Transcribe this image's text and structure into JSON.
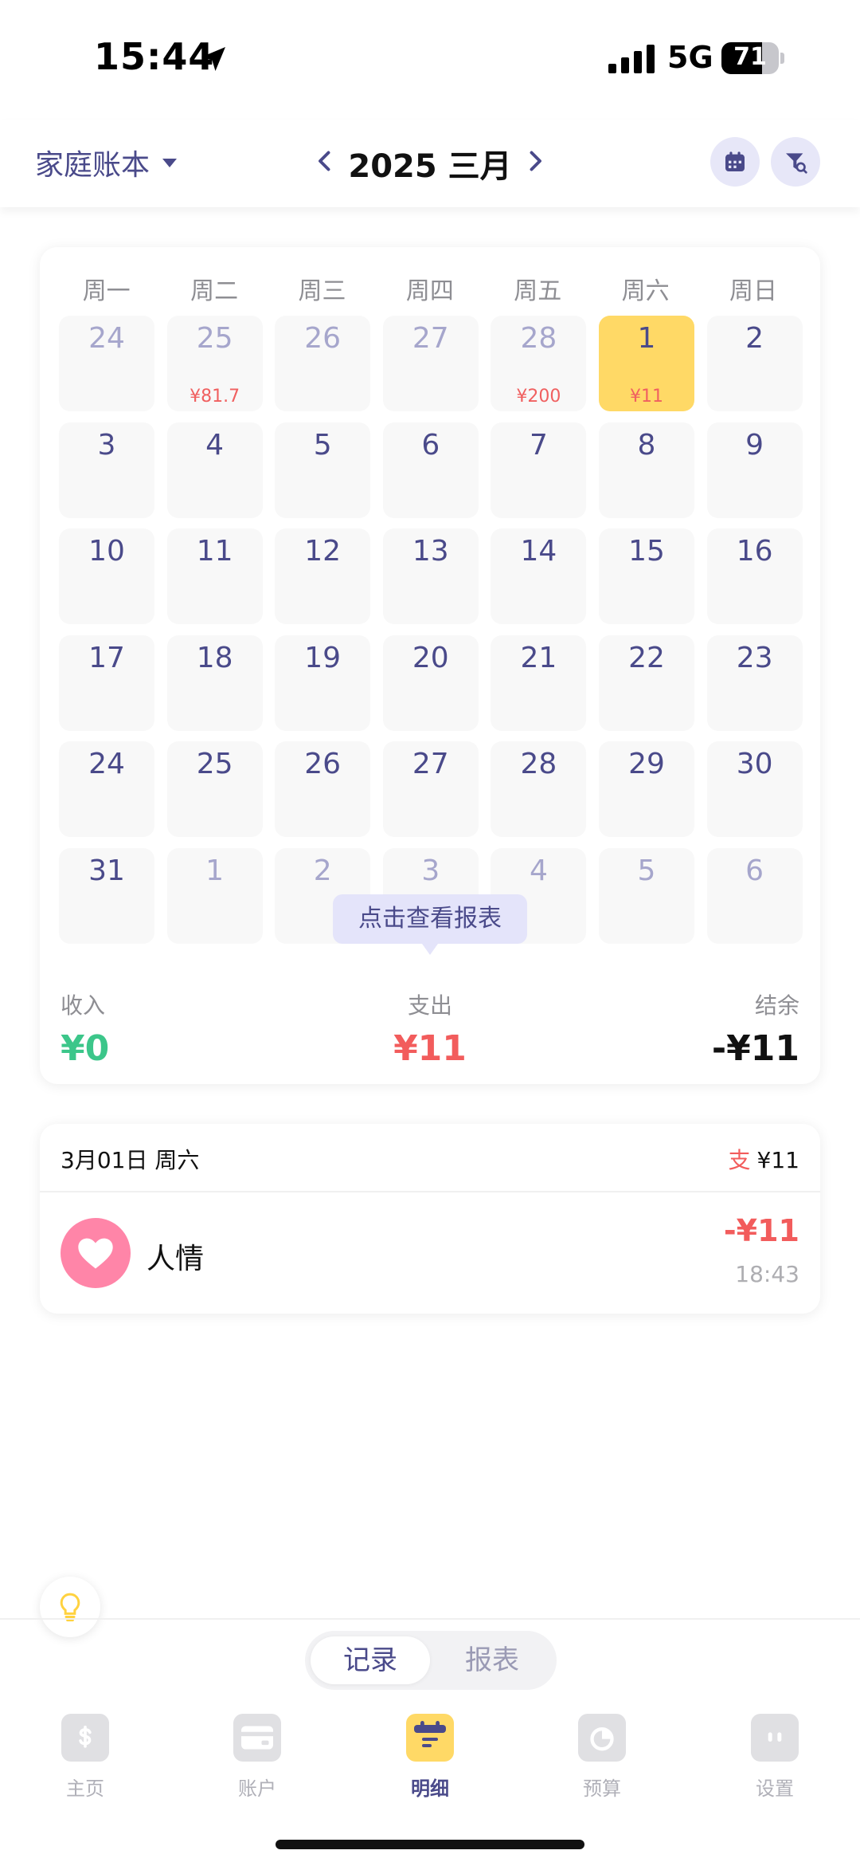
{
  "status_bar": {
    "time": "15:44",
    "network": "5G",
    "battery_level": "71",
    "battery_fraction": 0.71
  },
  "header": {
    "ledger_name": "家庭账本",
    "month_title": "2025 三月",
    "icons": {
      "calendar": "calendar-icon",
      "filter": "filter-search-icon",
      "prev": "chevron-left-icon",
      "next": "chevron-right-icon"
    }
  },
  "calendar": {
    "weekdays": [
      "周一",
      "周二",
      "周三",
      "周四",
      "周五",
      "周六",
      "周日"
    ],
    "weeks": [
      [
        {
          "day": "24",
          "muted": true,
          "amount": ""
        },
        {
          "day": "25",
          "muted": true,
          "amount": "¥81.7"
        },
        {
          "day": "26",
          "muted": true,
          "amount": ""
        },
        {
          "day": "27",
          "muted": true,
          "amount": ""
        },
        {
          "day": "28",
          "muted": true,
          "amount": "¥200"
        },
        {
          "day": "1",
          "muted": false,
          "amount": "¥11",
          "selected": true
        },
        {
          "day": "2",
          "muted": false,
          "amount": ""
        }
      ],
      [
        {
          "day": "3",
          "muted": false,
          "amount": ""
        },
        {
          "day": "4",
          "muted": false,
          "amount": ""
        },
        {
          "day": "5",
          "muted": false,
          "amount": ""
        },
        {
          "day": "6",
          "muted": false,
          "amount": ""
        },
        {
          "day": "7",
          "muted": false,
          "amount": ""
        },
        {
          "day": "8",
          "muted": false,
          "amount": ""
        },
        {
          "day": "9",
          "muted": false,
          "amount": ""
        }
      ],
      [
        {
          "day": "10",
          "muted": false,
          "amount": ""
        },
        {
          "day": "11",
          "muted": false,
          "amount": ""
        },
        {
          "day": "12",
          "muted": false,
          "amount": ""
        },
        {
          "day": "13",
          "muted": false,
          "amount": ""
        },
        {
          "day": "14",
          "muted": false,
          "amount": ""
        },
        {
          "day": "15",
          "muted": false,
          "amount": ""
        },
        {
          "day": "16",
          "muted": false,
          "amount": ""
        }
      ],
      [
        {
          "day": "17",
          "muted": false,
          "amount": ""
        },
        {
          "day": "18",
          "muted": false,
          "amount": ""
        },
        {
          "day": "19",
          "muted": false,
          "amount": ""
        },
        {
          "day": "20",
          "muted": false,
          "amount": ""
        },
        {
          "day": "21",
          "muted": false,
          "amount": ""
        },
        {
          "day": "22",
          "muted": false,
          "amount": ""
        },
        {
          "day": "23",
          "muted": false,
          "amount": ""
        }
      ],
      [
        {
          "day": "24",
          "muted": false,
          "amount": ""
        },
        {
          "day": "25",
          "muted": false,
          "amount": ""
        },
        {
          "day": "26",
          "muted": false,
          "amount": ""
        },
        {
          "day": "27",
          "muted": false,
          "amount": ""
        },
        {
          "day": "28",
          "muted": false,
          "amount": ""
        },
        {
          "day": "29",
          "muted": false,
          "amount": ""
        },
        {
          "day": "30",
          "muted": false,
          "amount": ""
        }
      ],
      [
        {
          "day": "31",
          "muted": false,
          "amount": ""
        },
        {
          "day": "1",
          "muted": true,
          "amount": ""
        },
        {
          "day": "2",
          "muted": true,
          "amount": ""
        },
        {
          "day": "3",
          "muted": true,
          "amount": ""
        },
        {
          "day": "4",
          "muted": true,
          "amount": ""
        },
        {
          "day": "5",
          "muted": true,
          "amount": ""
        },
        {
          "day": "6",
          "muted": true,
          "amount": ""
        }
      ]
    ],
    "tooltip": "点击查看报表"
  },
  "summary": {
    "income_label": "收入",
    "income_value": "¥0",
    "expense_label": "支出",
    "expense_value": "¥11",
    "balance_label": "结余",
    "balance_value": "-¥11"
  },
  "transactions": {
    "date": "3月01日 周六",
    "day_total_tag": "支",
    "day_total": "¥11",
    "items": [
      {
        "name": "人情",
        "amount": "-¥11",
        "time": "18:43",
        "icon": "heart-icon"
      }
    ]
  },
  "tip_icon": "lightbulb-icon",
  "view_toggle": {
    "record": "记录",
    "report": "报表"
  },
  "tabs": [
    {
      "label": "主页",
      "icon": "dollar-icon",
      "active": false
    },
    {
      "label": "账户",
      "icon": "card-icon",
      "active": false
    },
    {
      "label": "明细",
      "icon": "list-icon",
      "active": true
    },
    {
      "label": "预算",
      "icon": "budget-icon",
      "active": false
    },
    {
      "label": "设置",
      "icon": "settings-icon",
      "active": false
    }
  ],
  "colors": {
    "accent": "#4a4a8a",
    "selected_day": "#ffd966",
    "income": "#3cc68a",
    "expense": "#f25c5c",
    "heart": "#ff85a8"
  }
}
